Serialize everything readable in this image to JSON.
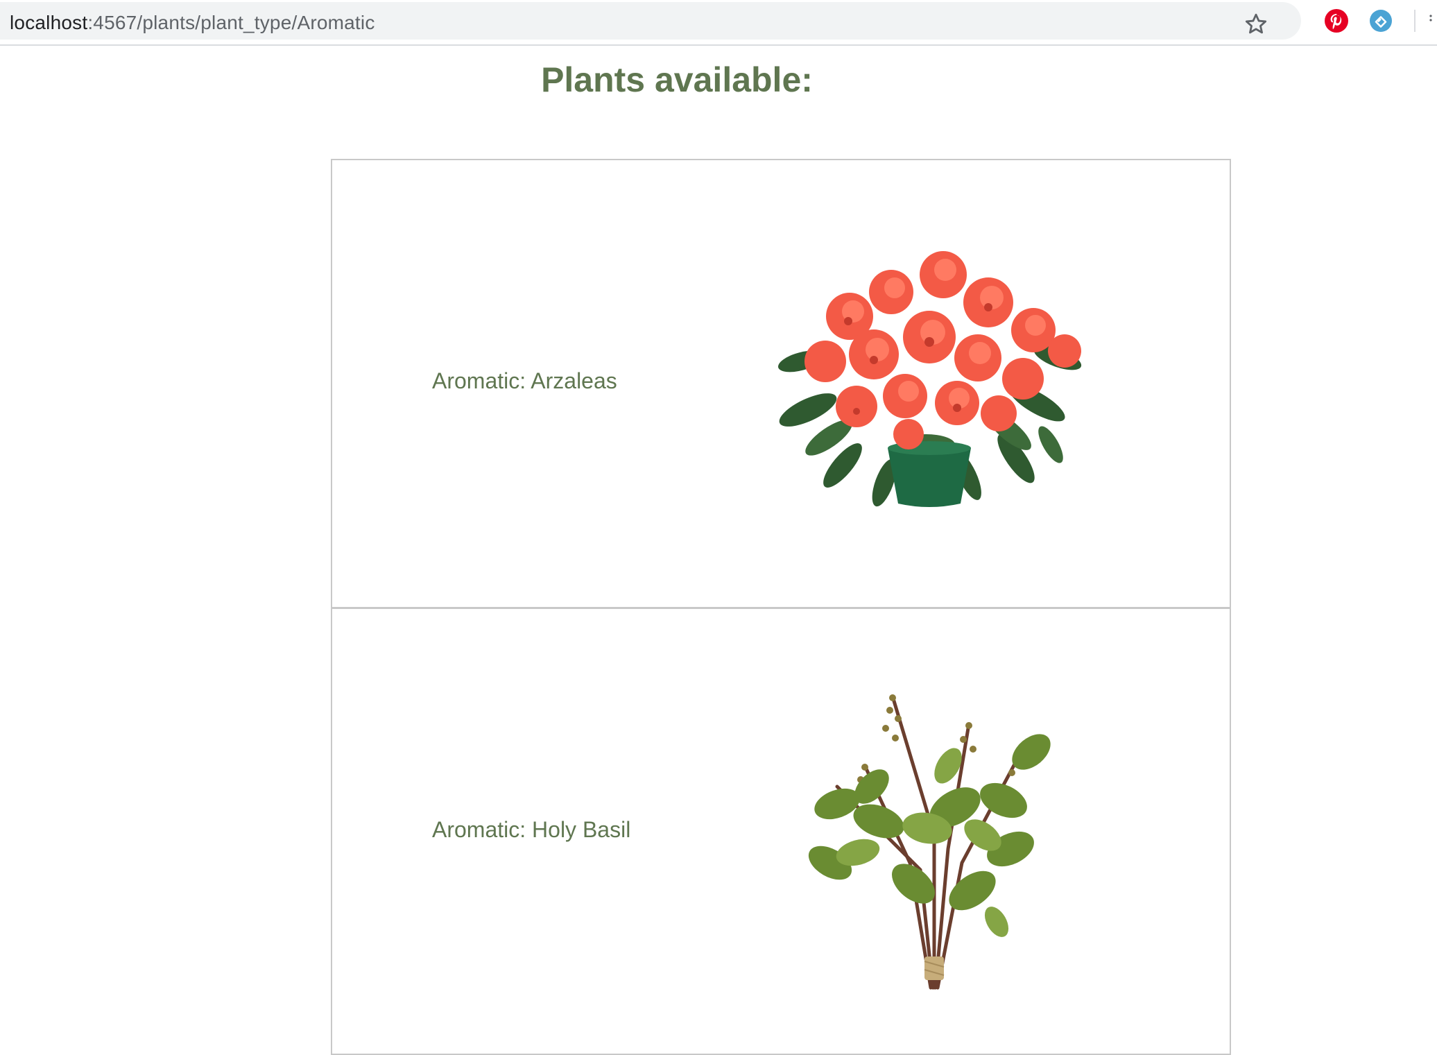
{
  "browser": {
    "url_host": "localhost",
    "url_path": ":4567/plants/plant_type/Aromatic",
    "icons": {
      "info": "info-icon",
      "bookmark": "star-icon",
      "extension_1": "pinterest-icon",
      "extension_2": "extension-icon"
    },
    "colors": {
      "pinterest": "#e60023",
      "extension": "#4ba3d4"
    }
  },
  "page": {
    "title": "Plants available:",
    "text_color": "#5f7650",
    "plants": [
      {
        "label": "Aromatic: Arzaleas",
        "image": "potted red azalea"
      },
      {
        "label": "Aromatic: Holy Basil",
        "image": "holy basil bunch"
      }
    ]
  }
}
